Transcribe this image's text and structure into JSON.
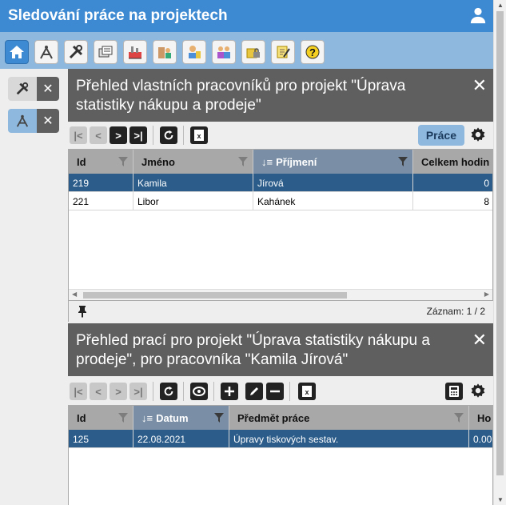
{
  "app": {
    "title": "Sledování práce na projektech"
  },
  "colors": {
    "primary": "#3d8ad2",
    "toolbar": "#8eb8de",
    "panel_header": "#5f5f5f",
    "selected_row": "#2b5c8a",
    "grid_header": "#a8a8a8",
    "sorted_header": "#7a8fa6"
  },
  "toolbar": {
    "icons": [
      "home-icon",
      "compass-icon",
      "tools-icon",
      "documents-icon",
      "factory-icon",
      "building-people-icon",
      "worker-icon",
      "team-icon",
      "lock-folder-icon",
      "note-edit-icon",
      "help-icon"
    ]
  },
  "side_tabs": [
    {
      "icon": "tools-icon",
      "close": "✕"
    },
    {
      "icon": "compass-icon",
      "close": "✕"
    }
  ],
  "panel1": {
    "title": "Přehled vlastních pracovníků pro projekt \"Úprava statistiky nákupu a prodeje\"",
    "close": "✕",
    "prace_label": "Práce",
    "columns": [
      "Id",
      "Jméno",
      "Příjmení",
      "Celkem hodin"
    ],
    "rows": [
      {
        "id": "219",
        "jmeno": "Kamila",
        "prijmeni": "Jírová",
        "hodin": "0"
      },
      {
        "id": "221",
        "jmeno": "Libor",
        "prijmeni": "Kahánek",
        "hodin": "8"
      }
    ],
    "record_count": "Záznam: 1 / 2"
  },
  "panel2": {
    "title": "Přehled prací pro projekt \"Úprava statistiky nákupu a prodeje\", pro pracovníka \"Kamila Jírová\"",
    "close": "✕",
    "columns": [
      "Id",
      "Datum",
      "Předmět práce",
      "Ho"
    ],
    "rows": [
      {
        "id": "125",
        "datum": "22.08.2021",
        "predmet": "Úpravy tiskových sestav.",
        "hod": "0.00"
      }
    ]
  },
  "nav": {
    "first": "|<",
    "prev": "<",
    "next": ">",
    "last": ">|"
  }
}
